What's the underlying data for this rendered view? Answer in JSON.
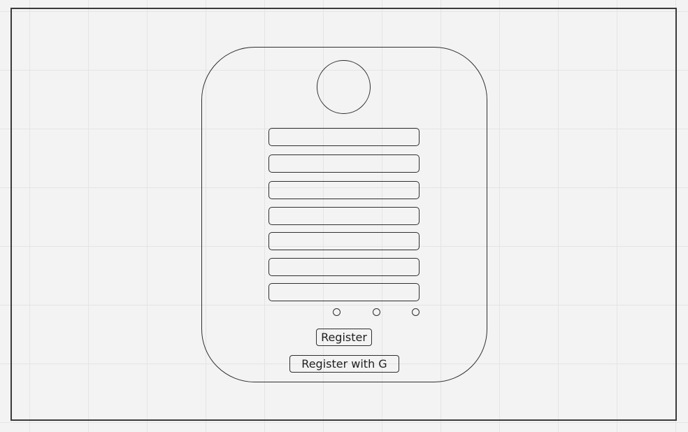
{
  "form": {
    "fields": [
      {
        "value": "",
        "placeholder": ""
      },
      {
        "value": "",
        "placeholder": ""
      },
      {
        "value": "",
        "placeholder": ""
      },
      {
        "value": "",
        "placeholder": ""
      },
      {
        "value": "",
        "placeholder": ""
      },
      {
        "value": "",
        "placeholder": ""
      },
      {
        "value": "",
        "placeholder": ""
      }
    ],
    "register_label": "Register",
    "register_google_label": "Register with G"
  }
}
